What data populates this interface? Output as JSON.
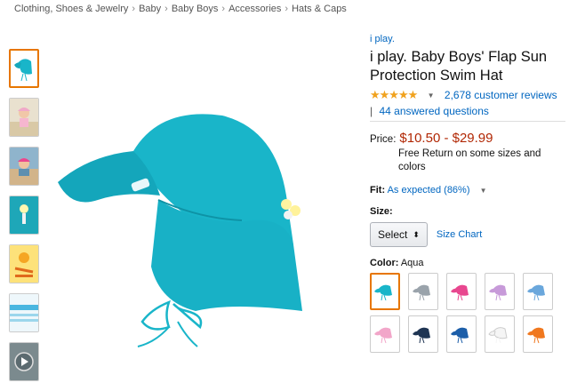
{
  "breadcrumb": [
    "Clothing, Shoes & Jewelry",
    "Baby",
    "Baby Boys",
    "Accessories",
    "Hats & Caps"
  ],
  "breadcrumb_sep": "›",
  "product": {
    "brand": "i play.",
    "title": "i play. Baby Boys' Flap Sun Protection Swim Hat",
    "rating_stars": 4.5,
    "stars_glyphs": "★★★★★",
    "reviews_text": "2,678 customer reviews",
    "qa_sep": "|",
    "qa_text": "44 answered questions",
    "price_label": "Price:",
    "price": "$10.50 - $29.99",
    "free_return": "Free Return on some sizes and colors",
    "fit_label": "Fit:",
    "fit_value": "As expected (86%)",
    "size_label": "Size:",
    "size_select": "Select",
    "size_chart": "Size Chart",
    "color_label": "Color:",
    "color_value": "Aqua"
  },
  "colors": {
    "accent": "#e77600",
    "link": "#0066c0",
    "price": "#b12704",
    "star": "#f0a21e",
    "hat_main": "#19b5c9"
  },
  "swatches": [
    "#19b5c9",
    "#9aa3ab",
    "#e8478f",
    "#c79ad9",
    "#6aa7dc",
    "#f2a6c9",
    "#1f3553",
    "#1c5ea9",
    "#f5f5f5",
    "#f0781f"
  ],
  "thumb_icons": [
    "hat-front-icon",
    "baby-beach-photo-icon",
    "baby-water-photo-icon",
    "hat-tag-icon",
    "upf-chart-icon",
    "size-banner-icon",
    "video-play-icon"
  ]
}
